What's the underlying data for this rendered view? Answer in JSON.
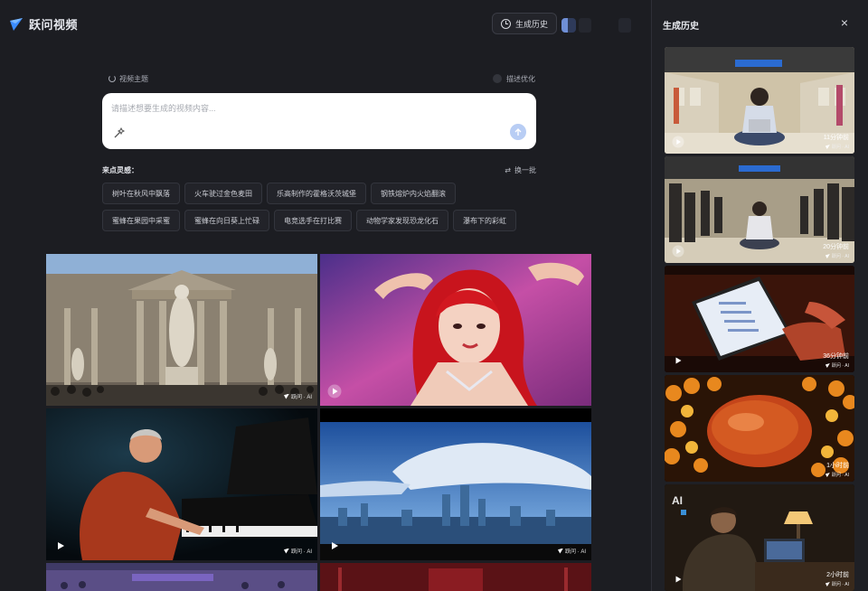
{
  "app": {
    "name": "跃问视频"
  },
  "header": {
    "history_button": "生成历史"
  },
  "prompt": {
    "theme_label": "视频主题",
    "optimize_label": "描述优化",
    "placeholder": "请描述想要生成的视频内容..."
  },
  "inspiration": {
    "title": "来点灵感：",
    "shuffle_label": "换一批",
    "row1": [
      "树叶在秋风中飘落",
      "火车驶过金色麦田",
      "乐高制作的霍格沃茨城堡",
      "钢铁熔炉内火焰翻滚"
    ],
    "row2": [
      "蜜蜂在果园中采蜜",
      "蜜蜂在向日葵上忙碌",
      "电竞选手在打比赛",
      "动物学家发现恐龙化石",
      "瀑布下的彩虹"
    ]
  },
  "gallery": {
    "watermark": "跃问 · AI",
    "cards": [
      {
        "subject": "statue-courtyard"
      },
      {
        "subject": "red-hair-dancer"
      },
      {
        "subject": "pianist"
      },
      {
        "subject": "city-skyline"
      }
    ]
  },
  "history": {
    "title": "生成历史",
    "close": "×",
    "watermark": "跃问 · AI",
    "items": [
      {
        "time": "11分钟前",
        "subject": "subway-laptop"
      },
      {
        "time": "20分钟前",
        "subject": "subway-crowd"
      },
      {
        "time": "36分钟前",
        "subject": "phone-hand"
      },
      {
        "time": "1小时前",
        "subject": "salmon-roe"
      },
      {
        "time": "2小时前",
        "subject": "man-with-lamp"
      }
    ]
  },
  "colors": {
    "accent": "#3b8cff",
    "background": "#1c1d22",
    "panel": "#1f2025",
    "send_button": "#b8cdf4"
  }
}
